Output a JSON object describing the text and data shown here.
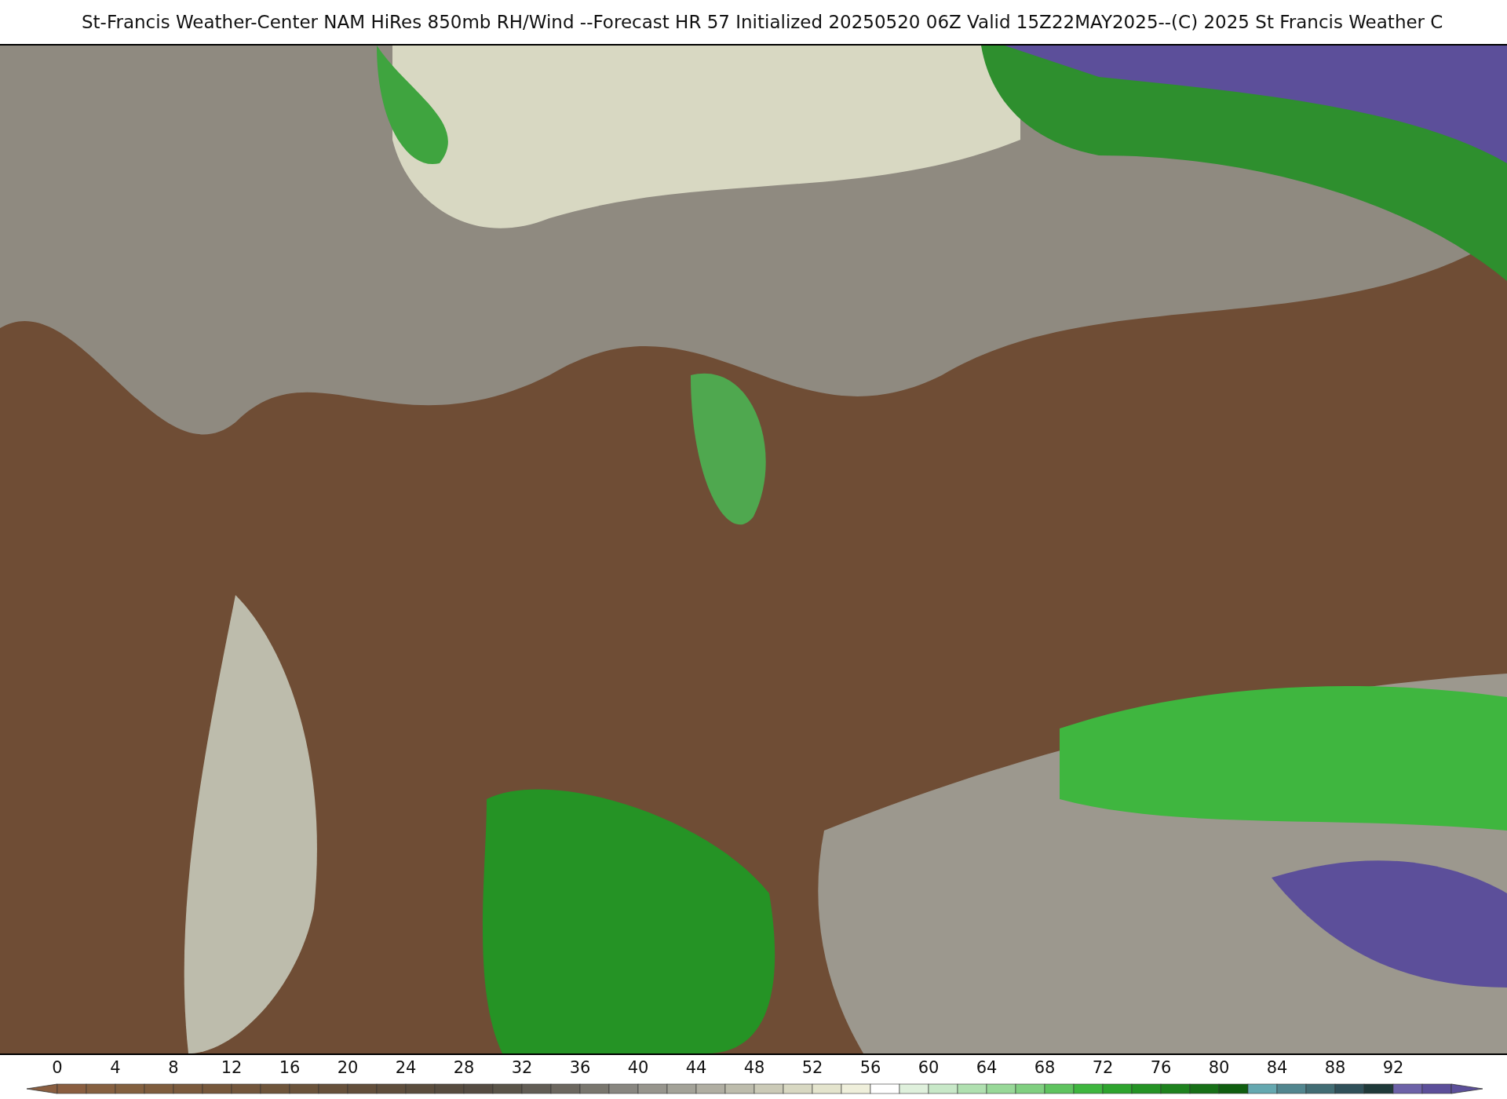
{
  "title": "St-Francis Weather-Center NAM HiRes 850mb RH/Wind  --Forecast HR 57 Initialized 20250520 06Z Valid 15Z22MAY2025--(C) 2025 St Francis Weather C",
  "colorbar": {
    "ticks": [
      "0",
      "4",
      "8",
      "12",
      "16",
      "20",
      "24",
      "28",
      "32",
      "36",
      "40",
      "44",
      "48",
      "52",
      "56",
      "60",
      "64",
      "68",
      "72",
      "76",
      "80",
      "84",
      "88",
      "92"
    ]
  }
}
